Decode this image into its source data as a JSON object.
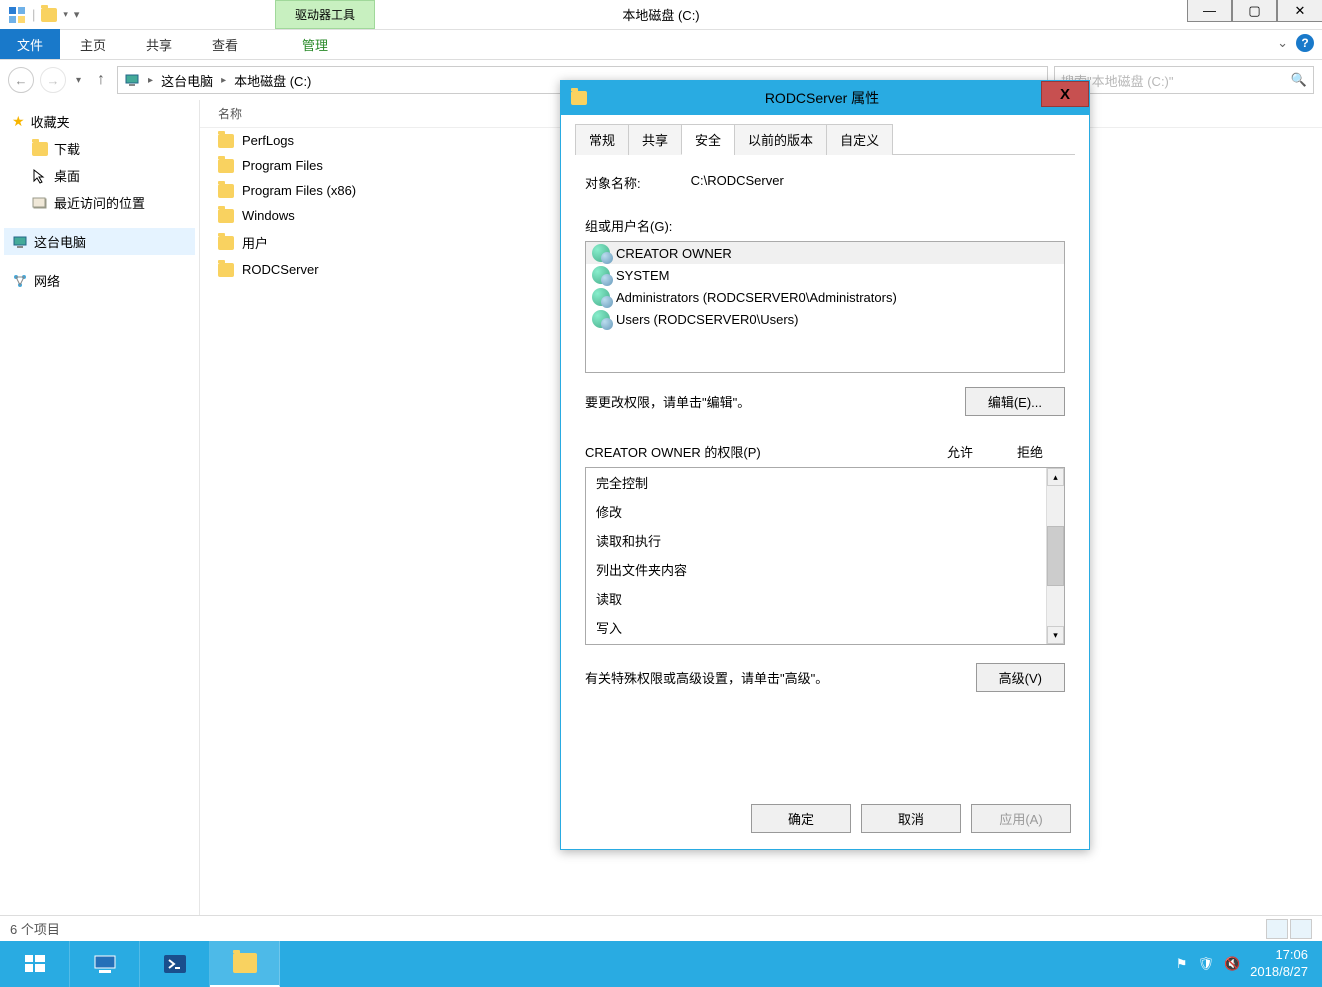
{
  "titlebar": {
    "drive_tools": "驱动器工具",
    "window_title": "本地磁盘 (C:)"
  },
  "ribbon": {
    "file": "文件",
    "home": "主页",
    "share": "共享",
    "view": "查看",
    "manage": "管理"
  },
  "breadcrumb": {
    "this_pc": "这台电脑",
    "drive": "本地磁盘 (C:)"
  },
  "search": {
    "placeholder": "搜索\"本地磁盘 (C:)\""
  },
  "sidebar": {
    "favorites": "收藏夹",
    "downloads": "下载",
    "desktop": "桌面",
    "recent": "最近访问的位置",
    "this_pc": "这台电脑",
    "network": "网络"
  },
  "columns": {
    "name": "名称"
  },
  "files": [
    {
      "name": "PerfLogs"
    },
    {
      "name": "Program Files"
    },
    {
      "name": "Program Files (x86)"
    },
    {
      "name": "Windows"
    },
    {
      "name": "用户"
    },
    {
      "name": "RODCServer"
    }
  ],
  "statusbar": {
    "items": "6 个项目"
  },
  "taskbar": {
    "time": "17:06",
    "date": "2018/8/27"
  },
  "dialog": {
    "title": "RODCServer 属性",
    "tabs": {
      "general": "常规",
      "sharing": "共享",
      "security": "安全",
      "previous": "以前的版本",
      "customize": "自定义"
    },
    "object_label": "对象名称:",
    "object_value": "C:\\RODCServer",
    "groups_label": "组或用户名(G):",
    "groups": [
      "CREATOR OWNER",
      "SYSTEM",
      "Administrators (RODCSERVER0\\Administrators)",
      "Users (RODCSERVER0\\Users)"
    ],
    "edit_hint": "要更改权限，请单击\"编辑\"。",
    "edit_btn": "编辑(E)...",
    "perm_header": "CREATOR OWNER 的权限(P)",
    "allow": "允许",
    "deny": "拒绝",
    "permissions": [
      "完全控制",
      "修改",
      "读取和执行",
      "列出文件夹内容",
      "读取",
      "写入"
    ],
    "adv_hint": "有关特殊权限或高级设置，请单击\"高级\"。",
    "adv_btn": "高级(V)",
    "ok": "确定",
    "cancel": "取消",
    "apply": "应用(A)"
  }
}
